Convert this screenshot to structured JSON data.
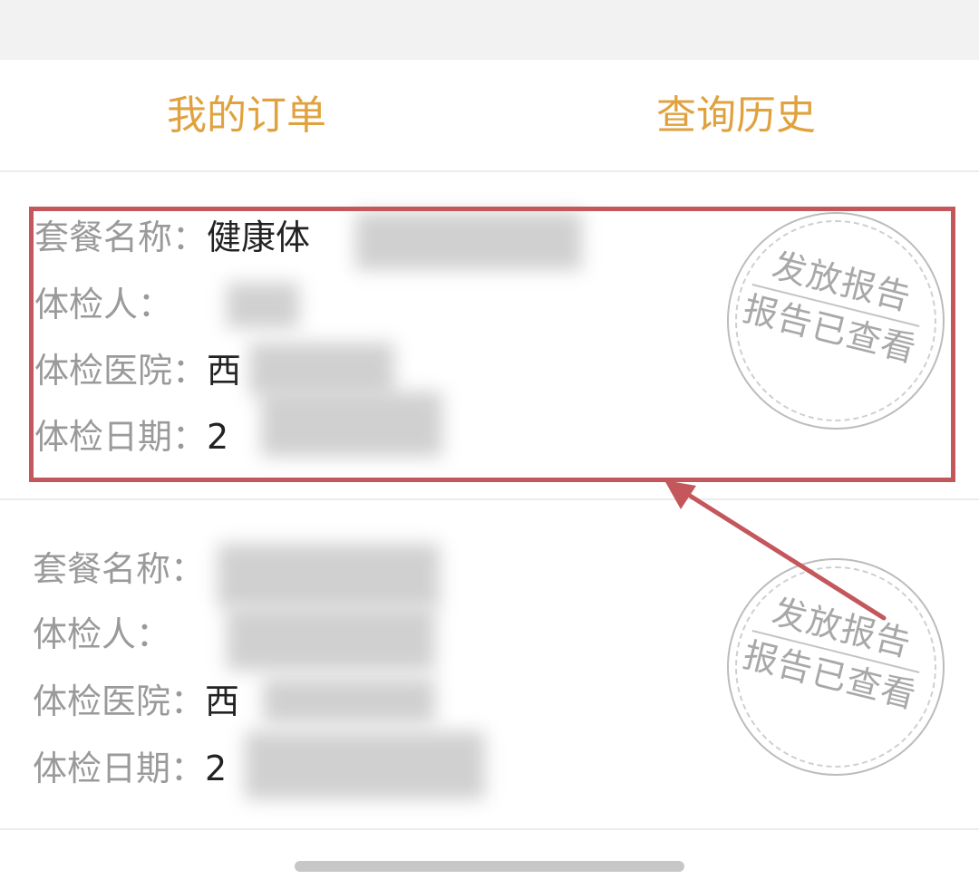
{
  "tabs": {
    "orders_label": "我的订单",
    "history_label": "查询历史",
    "active_color": "#e0a23e"
  },
  "labels": {
    "package": "套餐名称：",
    "person": "体检人：",
    "hospital": "体检医院：",
    "date": "体检日期："
  },
  "orders": [
    {
      "package_visible": "健康体",
      "person_visible": "",
      "hospital_visible": "西",
      "date_visible": "2"
    },
    {
      "package_visible": "",
      "person_visible": "",
      "hospital_visible": "西",
      "date_visible": "2"
    }
  ],
  "stamp": {
    "line1": "发放报告",
    "line2": "报告已查看"
  },
  "annotation_color": "#c3575c"
}
